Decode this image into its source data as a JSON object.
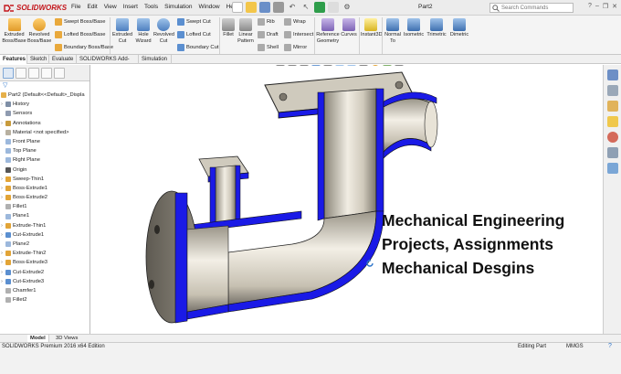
{
  "app": {
    "logo_text": "SOLIDWORKS",
    "document_title": "Part2",
    "search_placeholder": "Search Commands",
    "menus": [
      "File",
      "Edit",
      "View",
      "Insert",
      "Tools",
      "Simulation",
      "Window",
      "Help"
    ]
  },
  "ribbon": {
    "extruded_boss": "Extruded Boss/Base",
    "revolved_boss": "Revolved Boss/Base",
    "swept_boss": "Swept Boss/Base",
    "lofted_boss": "Lofted Boss/Base",
    "boundary_boss": "Boundary Boss/Base",
    "extruded_cut": "Extruded Cut",
    "hole_wizard": "Hole Wizard",
    "revolved_cut": "Revolved Cut",
    "swept_cut": "Swept Cut",
    "lofted_cut": "Lofted Cut",
    "boundary_cut": "Boundary Cut",
    "fillet": "Fillet",
    "linear_pattern": "Linear Pattern",
    "rib": "Rib",
    "draft": "Draft",
    "shell": "Shell",
    "wrap": "Wrap",
    "intersect": "Intersect",
    "mirror": "Mirror",
    "reference_geometry": "Reference Geometry",
    "curves": "Curves",
    "instant3d": "Instant3D",
    "normal_to": "Normal To",
    "isometric": "Isometric",
    "trimetric": "Trimetric",
    "dimetric": "Dimetric"
  },
  "command_tabs": [
    "Features",
    "Sketch",
    "Evaluate",
    "SOLIDWORKS Add-Ins",
    "Simulation"
  ],
  "feature_tree": {
    "root": "Part2  (Default<<Default>_Displa",
    "items": [
      {
        "label": "History",
        "icon": "history-icon",
        "expand": true
      },
      {
        "label": "Sensors",
        "icon": "sensor-icon",
        "expand": false
      },
      {
        "label": "Annotations",
        "icon": "annotation-icon",
        "expand": true
      },
      {
        "label": "Material <not specified>",
        "icon": "material-icon",
        "expand": false
      },
      {
        "label": "Front Plane",
        "icon": "plane-icon",
        "expand": false
      },
      {
        "label": "Top Plane",
        "icon": "plane-icon",
        "expand": false
      },
      {
        "label": "Right Plane",
        "icon": "plane-icon",
        "expand": false
      },
      {
        "label": "Origin",
        "icon": "origin-icon",
        "expand": false
      },
      {
        "label": "Sweep-Thin1",
        "icon": "sweep-icon",
        "expand": true
      },
      {
        "label": "Boss-Extrude1",
        "icon": "extrude-icon",
        "expand": true
      },
      {
        "label": "Boss-Extrude2",
        "icon": "extrude-icon",
        "expand": true
      },
      {
        "label": "Fillet1",
        "icon": "fillet-icon",
        "expand": false
      },
      {
        "label": "Plane1",
        "icon": "plane-icon",
        "expand": false
      },
      {
        "label": "Extrude-Thin1",
        "icon": "extrude-icon",
        "expand": true
      },
      {
        "label": "Cut-Extrude1",
        "icon": "cut-icon",
        "expand": true
      },
      {
        "label": "Plane2",
        "icon": "plane-icon",
        "expand": false
      },
      {
        "label": "Extrude-Thin2",
        "icon": "extrude-icon",
        "expand": true
      },
      {
        "label": "Boss-Extrude3",
        "icon": "extrude-icon",
        "expand": true
      },
      {
        "label": "Cut-Extrude2",
        "icon": "cut-icon",
        "expand": true
      },
      {
        "label": "Cut-Extrude3",
        "icon": "cut-icon",
        "expand": true
      },
      {
        "label": "Chamfer1",
        "icon": "chamfer-icon",
        "expand": false
      },
      {
        "label": "Fillet2",
        "icon": "fillet-icon",
        "expand": false
      }
    ]
  },
  "bottom_tabs": [
    "Model",
    "3D Views"
  ],
  "overlay": {
    "line1": "Mechanical Engineering",
    "line2": "Projects, Assignments",
    "line3": "Mechanical Desgins"
  },
  "status": {
    "edition": "SOLIDWORKS Premium 2016 x64 Edition",
    "mode": "Editing Part",
    "units": "MMGS"
  },
  "colors": {
    "section_blue": "#1a1ae6",
    "metal": "#d9d4c8",
    "brand_red": "#c4161c"
  }
}
